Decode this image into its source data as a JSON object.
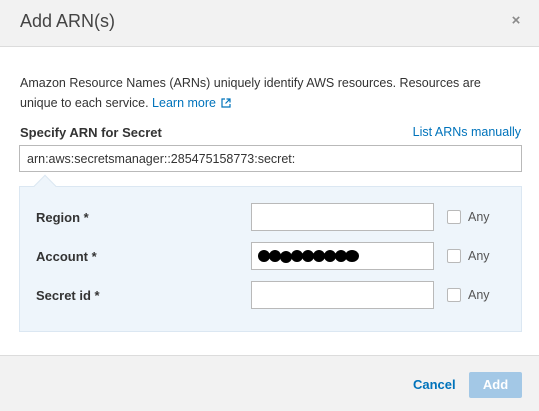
{
  "dialog": {
    "title": "Add ARN(s)",
    "close_label": "×"
  },
  "description": {
    "text": "Amazon Resource Names (ARNs) uniquely identify AWS resources. Resources are unique to each service.",
    "learn_more": "Learn more"
  },
  "arn": {
    "label": "Specify ARN for Secret",
    "list_link": "List ARNs manually",
    "value": "arn:aws:secretsmanager::285475158773:secret:"
  },
  "fields": {
    "region": {
      "label": "Region *",
      "value": "",
      "any_label": "Any",
      "any_checked": false
    },
    "account": {
      "label": "Account *",
      "value": "[redacted]",
      "any_label": "Any",
      "any_checked": false
    },
    "secret_id": {
      "label": "Secret id *",
      "value": "",
      "any_label": "Any",
      "any_checked": false
    }
  },
  "footer": {
    "cancel_label": "Cancel",
    "add_label": "Add"
  },
  "colors": {
    "link": "#0073bb",
    "add_button_disabled": "#a3c8e6",
    "panel_bg": "#eef5fb",
    "header_bg": "#f2f2f2"
  },
  "icons": {
    "close": "close-icon",
    "external_link": "external-link-icon"
  }
}
